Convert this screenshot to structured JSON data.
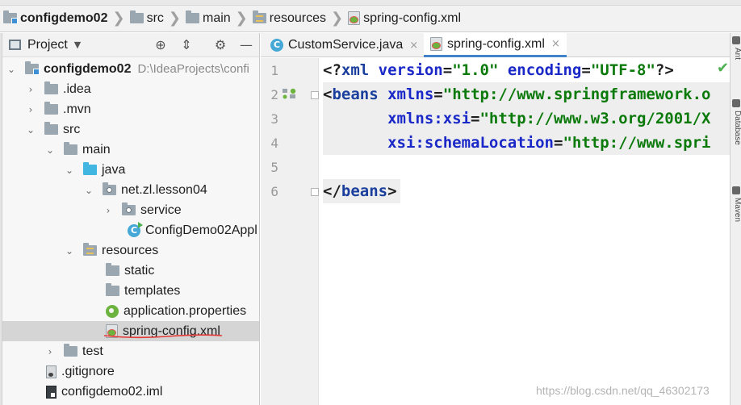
{
  "breadcrumb": {
    "items": [
      {
        "label": "configdemo02",
        "icon": "module-folder-icon"
      },
      {
        "label": "src",
        "icon": "folder-icon"
      },
      {
        "label": "main",
        "icon": "folder-icon"
      },
      {
        "label": "resources",
        "icon": "resources-folder-icon"
      },
      {
        "label": "spring-config.xml",
        "icon": "spring-xml-file-icon"
      }
    ],
    "separator": "❯"
  },
  "project_panel": {
    "title": "Project",
    "dropdown_glyph": "▼",
    "toolbar": {
      "locate": "⊕",
      "collapse": "⇕",
      "settings": "⚙",
      "hide": "—"
    },
    "tree": [
      {
        "label": "configdemo02",
        "path": "D:\\IdeaProjects\\confi",
        "expanded": true
      },
      {
        "label": ".idea",
        "expanded": false
      },
      {
        "label": ".mvn",
        "expanded": false
      },
      {
        "label": "src",
        "expanded": true
      },
      {
        "label": "main",
        "expanded": true
      },
      {
        "label": "java",
        "expanded": true
      },
      {
        "label": "net.zl.lesson04",
        "expanded": true
      },
      {
        "label": "service",
        "expanded": false
      },
      {
        "label": "ConfigDemo02Appl"
      },
      {
        "label": "resources",
        "expanded": true
      },
      {
        "label": "static"
      },
      {
        "label": "templates"
      },
      {
        "label": "application.properties"
      },
      {
        "label": "spring-config.xml",
        "selected": true
      },
      {
        "label": "test",
        "expanded": false
      },
      {
        "label": ".gitignore"
      },
      {
        "label": "configdemo02.iml"
      }
    ]
  },
  "editor": {
    "tabs": [
      {
        "label": "CustomService.java",
        "close": "×",
        "active": false
      },
      {
        "label": "spring-config.xml",
        "close": "×",
        "active": true
      }
    ],
    "line_numbers": [
      "1",
      "2",
      "3",
      "4",
      "5",
      "6"
    ],
    "lines": [
      [
        {
          "t": "<?",
          "c": "punc"
        },
        {
          "t": "xml ",
          "c": "tag"
        },
        {
          "t": "version",
          "c": "attr"
        },
        {
          "t": "=",
          "c": "punc"
        },
        {
          "t": "\"1.0\"",
          "c": "val"
        },
        {
          "t": " ",
          "c": "punc"
        },
        {
          "t": "encoding",
          "c": "attr"
        },
        {
          "t": "=",
          "c": "punc"
        },
        {
          "t": "\"UTF-8\"",
          "c": "val"
        },
        {
          "t": "?>",
          "c": "punc"
        }
      ],
      [
        {
          "t": "<",
          "c": "punc"
        },
        {
          "t": "beans ",
          "c": "tag"
        },
        {
          "t": "xmlns",
          "c": "attr"
        },
        {
          "t": "=",
          "c": "punc"
        },
        {
          "t": "\"http://www.springframework.o",
          "c": "val"
        }
      ],
      [
        {
          "t": "       ",
          "c": "punc"
        },
        {
          "t": "xmlns:xsi",
          "c": "attr"
        },
        {
          "t": "=",
          "c": "punc"
        },
        {
          "t": "\"http://www.w3.org/2001/X",
          "c": "val"
        }
      ],
      [
        {
          "t": "       ",
          "c": "punc"
        },
        {
          "t": "xsi:schemaLocation",
          "c": "attr"
        },
        {
          "t": "=",
          "c": "punc"
        },
        {
          "t": "\"http://www.spri",
          "c": "val"
        }
      ],
      [],
      [
        {
          "t": "</",
          "c": "punc"
        },
        {
          "t": "beans",
          "c": "tag"
        },
        {
          "t": ">",
          "c": "punc"
        }
      ]
    ],
    "status_check": "✔"
  },
  "right_strip": {
    "labels": [
      "Ant",
      "Database",
      "Maven"
    ]
  },
  "watermark": "https://blog.csdn.net/qq_46302173",
  "colors": {
    "tag": "#1b3f9c",
    "attr": "#1a28c8",
    "value": "#0b7a0b",
    "selection": "#d5d5d5",
    "active_tab_underline": "#4083c9",
    "annotation_red": "#e53935"
  }
}
